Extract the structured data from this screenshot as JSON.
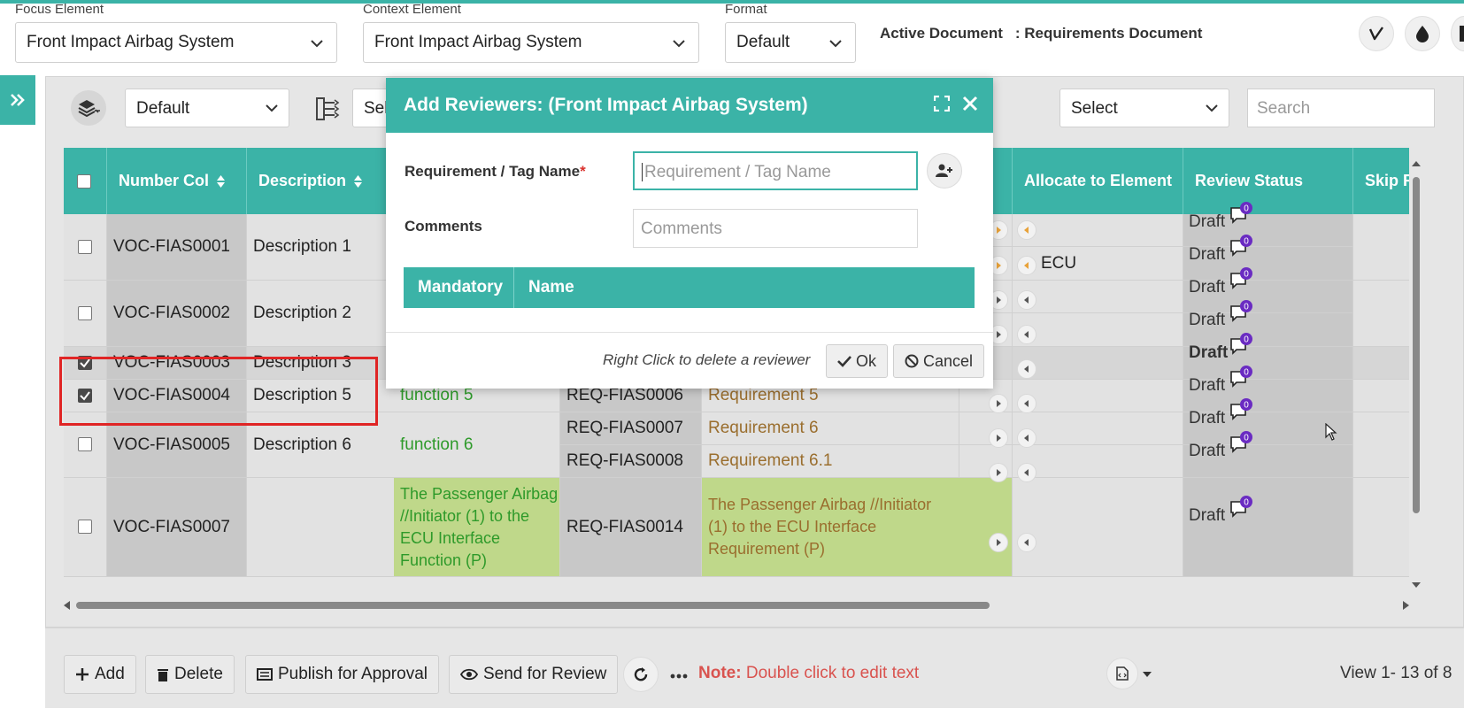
{
  "topbar": {
    "focus": {
      "label": "Focus Element",
      "value": "Front Impact Airbag System"
    },
    "context": {
      "label": "Context Element",
      "value": "Front Impact Airbag System"
    },
    "format": {
      "label": "Format",
      "value": "Default"
    },
    "active_document_label": "Active Document",
    "active_document_value": ": Requirements Document"
  },
  "toolbar": {
    "view_select": "Default",
    "hierarchy_select": "Sel",
    "filter_select": "Select",
    "search_placeholder": "Search"
  },
  "grid": {
    "headers": [
      "Number Col",
      "Description",
      "Allocate to Element",
      "Review Status",
      "Skip R"
    ],
    "rows": {
      "r1": {
        "number": "VOC-FIAS0001",
        "description": "Description 1",
        "allocate2": "ECU"
      },
      "r2": {
        "number": "VOC-FIAS0002",
        "description": "Description 2"
      },
      "r3": {
        "number": "VOC-FIAS0003",
        "description": "Description 3"
      },
      "r4": {
        "number": "VOC-FIAS0004",
        "description": "Description 5",
        "function": "function 5",
        "req_id": "REQ-FIAS0006",
        "req": "Requirement 5"
      },
      "r5": {
        "number": "VOC-FIAS0005",
        "description": "Description 6",
        "function": "function 6",
        "req_id_a": "REQ-FIAS0007",
        "req_a": "Requirement 6",
        "req_id_b": "REQ-FIAS0008",
        "req_b": "Requirement 6.1"
      },
      "r6": {
        "number": "VOC-FIAS0007",
        "description": "",
        "function_lines": [
          "The Passenger Airbag",
          "//Initiator (1) to the",
          "ECU Interface",
          "Function (P)"
        ],
        "req_id": "REQ-FIAS0014",
        "req_lines": [
          "The Passenger Airbag //Initiator",
          "(1) to the ECU Interface",
          "Requirement (P)"
        ]
      }
    },
    "review_status": "Draft",
    "comment_count": "0"
  },
  "bottom": {
    "add": "Add",
    "delete": "Delete",
    "publish": "Publish for Approval",
    "send_review": "Send for Review",
    "note_label": "Note:",
    "note_text": " Double click to edit text",
    "view_count": "View 1- 13 of 8"
  },
  "modal": {
    "title": "Add Reviewers: (Front Impact Airbag System)",
    "req_label": "Requirement / Tag Name",
    "required_mark": "*",
    "req_placeholder": "Requirement / Tag Name",
    "comments_label": "Comments",
    "comments_placeholder": "Comments",
    "table_headers": [
      "Mandatory",
      "Name"
    ],
    "hint": "Right Click to delete a reviewer",
    "ok": "Ok",
    "cancel": "Cancel"
  },
  "colors": {
    "accent": "#3bb3a7",
    "highlight_row": "#bfd88a",
    "function_text": "#2e9a2a",
    "requirement_text": "#9a6e2e",
    "comment_badge": "#6a2bc2",
    "note_text": "#d9534f"
  }
}
